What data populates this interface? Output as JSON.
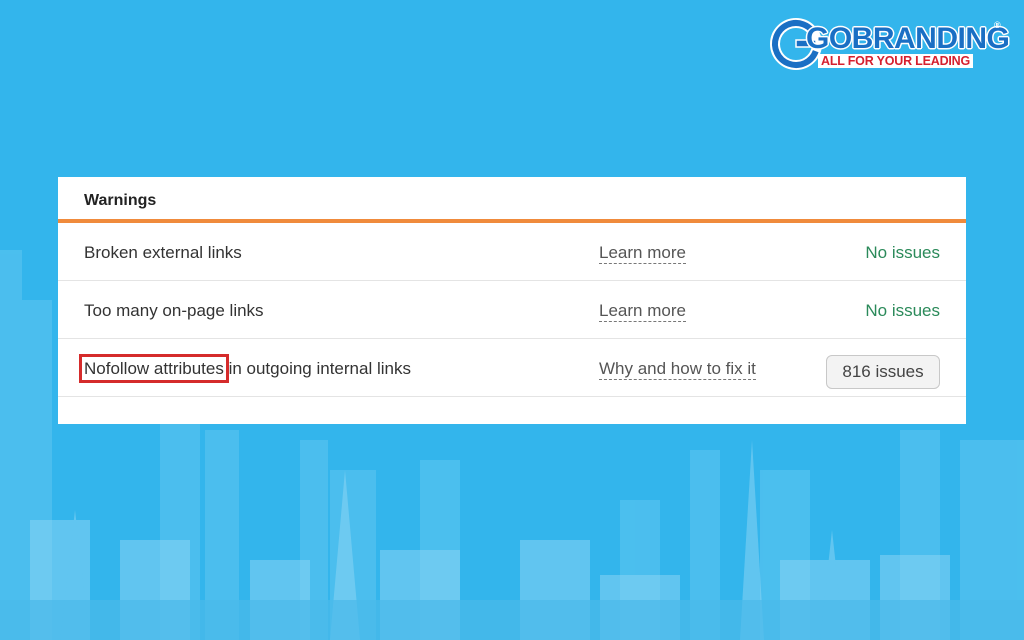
{
  "logo": {
    "brand": "GOBRANDING",
    "tagline": "ALL FOR YOUR LEADING",
    "registered": "®",
    "primary_color": "#1a6fc4",
    "accent_color": "#d6202f"
  },
  "panel": {
    "title": "Warnings",
    "accent_color": "#f08b3c",
    "rows": [
      {
        "name": "Broken external links",
        "help": "Learn more",
        "status": "No issues"
      },
      {
        "name": "Too many on-page links",
        "help": "Learn more",
        "status": "No issues"
      },
      {
        "name_highlight": "Nofollow attributes",
        "name_rest": " in outgoing internal links",
        "help": "Why and how to fix it",
        "issues": "816 issues"
      }
    ]
  },
  "colors": {
    "background": "#33b5ec",
    "ok_status": "#2b8a5a",
    "highlight_box": "#d52b2b"
  }
}
